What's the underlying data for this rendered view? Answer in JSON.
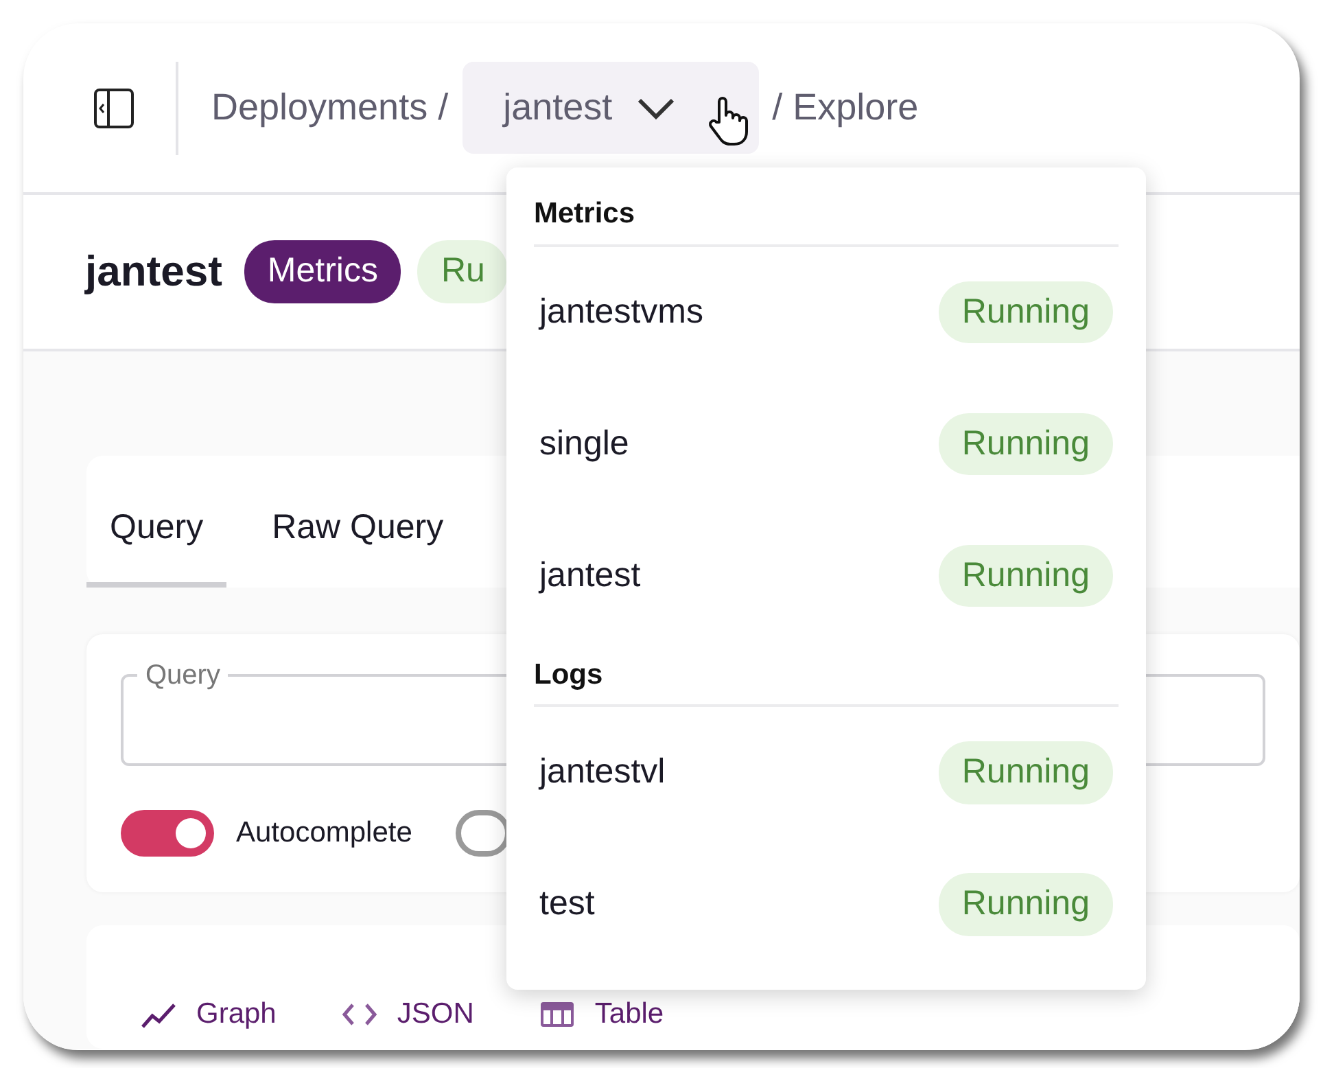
{
  "breadcrumb": {
    "root": "Deployments /",
    "current": "jantest",
    "tail": "/ Explore"
  },
  "header": {
    "title": "jantest",
    "badges": [
      {
        "label": "Metrics",
        "kind": "type"
      },
      {
        "label": "Ru",
        "kind": "status"
      }
    ]
  },
  "tabs": [
    {
      "label": "Query",
      "selected": true
    },
    {
      "label": "Raw Query",
      "selected": false
    }
  ],
  "query": {
    "label": "Query"
  },
  "switches": [
    {
      "label": "Autocomplete",
      "on": true
    },
    {
      "on": false
    }
  ],
  "result_tabs": [
    {
      "label": "Graph",
      "kind": "graph"
    },
    {
      "label": "JSON",
      "kind": "json"
    },
    {
      "label": "Table",
      "kind": "table"
    }
  ],
  "dropdown": {
    "expanded": true,
    "groups": [
      {
        "title": "Metrics",
        "items": [
          {
            "name": "jantestvms",
            "status": "Running"
          },
          {
            "name": "single",
            "status": "Running"
          },
          {
            "name": "jantest",
            "status": "Running"
          }
        ]
      },
      {
        "title": "Logs",
        "items": [
          {
            "name": "jantestvl",
            "status": "Running"
          },
          {
            "name": "test",
            "status": "Running"
          }
        ]
      }
    ]
  }
}
